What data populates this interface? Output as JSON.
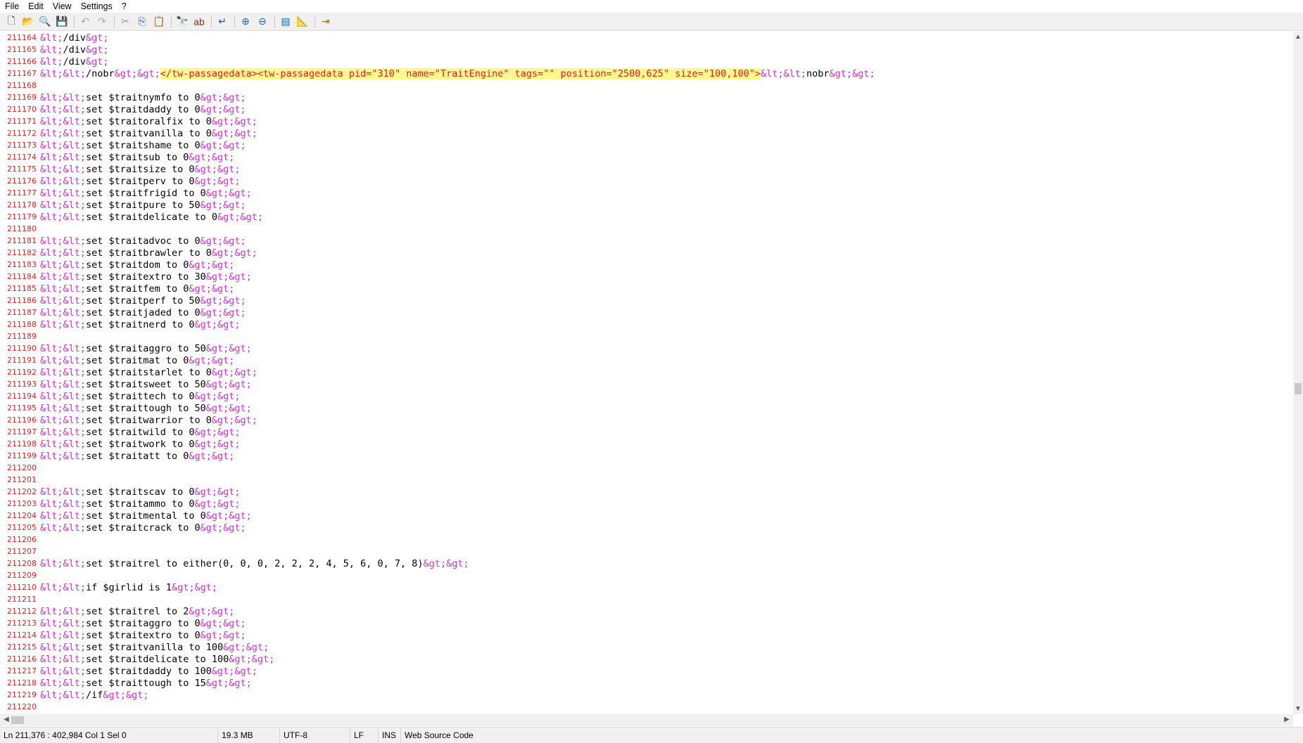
{
  "menu": [
    "File",
    "Edit",
    "View",
    "Settings",
    "?"
  ],
  "toolbar": [
    {
      "name": "new-file-icon",
      "g": "🗋",
      "c": "#333"
    },
    {
      "name": "open-file-icon",
      "g": "📂",
      "c": "#d8a020"
    },
    {
      "name": "browse-icon",
      "g": "🔍",
      "c": "#c89030"
    },
    {
      "name": "save-icon",
      "g": "💾",
      "c": "#3050a0"
    },
    {
      "sep": true
    },
    {
      "name": "undo-icon",
      "g": "↶",
      "c": "#9ab"
    },
    {
      "name": "redo-icon",
      "g": "↷",
      "c": "#9ab"
    },
    {
      "sep": true
    },
    {
      "name": "cut-icon",
      "g": "✂",
      "c": "#999"
    },
    {
      "name": "copy-icon",
      "g": "⎘",
      "c": "#3060b0"
    },
    {
      "name": "paste-icon",
      "g": "📋",
      "c": "#b08030"
    },
    {
      "sep": true
    },
    {
      "name": "find-icon",
      "g": "🔭",
      "c": "#333"
    },
    {
      "name": "replace-icon",
      "g": "ab",
      "c": "#a02020"
    },
    {
      "sep": true
    },
    {
      "name": "word-wrap-icon",
      "g": "↵",
      "c": "#2050a0"
    },
    {
      "sep": true
    },
    {
      "name": "zoom-in-icon",
      "g": "⊕",
      "c": "#3060a0"
    },
    {
      "name": "zoom-out-icon",
      "g": "⊖",
      "c": "#3060a0"
    },
    {
      "sep": true
    },
    {
      "name": "view-schemes-icon",
      "g": "▤",
      "c": "#2060b0"
    },
    {
      "name": "customize-icon",
      "g": "📐",
      "c": "#d09020"
    },
    {
      "sep": true
    },
    {
      "name": "exit-icon",
      "g": "⇥",
      "c": "#a07020"
    }
  ],
  "lines": [
    {
      "n": "211164",
      "code": "&lt;/div&gt;"
    },
    {
      "n": "211165",
      "code": "&lt;/div&gt;"
    },
    {
      "n": "211166",
      "code": "&lt;/div&gt;"
    },
    {
      "n": "211167",
      "code": "&lt;&lt;/nobr&gt;&gt;",
      "hl": "</tw-passagedata><tw-passagedata pid=\"310\" name=\"TraitEngine\" tags=\"\" position=\"2500,625\" size=\"100,100\">",
      "tail": "&lt;&lt;nobr&gt;&gt;"
    },
    {
      "n": "211168",
      "code": ""
    },
    {
      "n": "211169",
      "code": "&lt;&lt;set $traitnymfo to 0&gt;&gt;"
    },
    {
      "n": "211170",
      "code": "&lt;&lt;set $traitdaddy to 0&gt;&gt;"
    },
    {
      "n": "211171",
      "code": "&lt;&lt;set $traitoralfix to 0&gt;&gt;"
    },
    {
      "n": "211172",
      "code": "&lt;&lt;set $traitvanilla to 0&gt;&gt;"
    },
    {
      "n": "211173",
      "code": "&lt;&lt;set $traitshame to 0&gt;&gt;"
    },
    {
      "n": "211174",
      "code": "&lt;&lt;set $traitsub to 0&gt;&gt;"
    },
    {
      "n": "211175",
      "code": "&lt;&lt;set $traitsize to 0&gt;&gt;"
    },
    {
      "n": "211176",
      "code": "&lt;&lt;set $traitperv to 0&gt;&gt;"
    },
    {
      "n": "211177",
      "code": "&lt;&lt;set $traitfrigid to 0&gt;&gt;"
    },
    {
      "n": "211178",
      "code": "&lt;&lt;set $traitpure to 50&gt;&gt;"
    },
    {
      "n": "211179",
      "code": "&lt;&lt;set $traitdelicate to 0&gt;&gt;"
    },
    {
      "n": "211180",
      "code": ""
    },
    {
      "n": "211181",
      "code": "&lt;&lt;set $traitadvoc to 0&gt;&gt;"
    },
    {
      "n": "211182",
      "code": "&lt;&lt;set $traitbrawler to 0&gt;&gt;"
    },
    {
      "n": "211183",
      "code": "&lt;&lt;set $traitdom to 0&gt;&gt;"
    },
    {
      "n": "211184",
      "code": "&lt;&lt;set $traitextro to 30&gt;&gt;"
    },
    {
      "n": "211185",
      "code": "&lt;&lt;set $traitfem to 0&gt;&gt;"
    },
    {
      "n": "211186",
      "code": "&lt;&lt;set $traitperf to 50&gt;&gt;"
    },
    {
      "n": "211187",
      "code": "&lt;&lt;set $traitjaded to 0&gt;&gt;"
    },
    {
      "n": "211188",
      "code": "&lt;&lt;set $traitnerd to 0&gt;&gt;"
    },
    {
      "n": "211189",
      "code": ""
    },
    {
      "n": "211190",
      "code": "&lt;&lt;set $traitaggro to 50&gt;&gt;"
    },
    {
      "n": "211191",
      "code": "&lt;&lt;set $traitmat to 0&gt;&gt;"
    },
    {
      "n": "211192",
      "code": "&lt;&lt;set $traitstarlet to 0&gt;&gt;"
    },
    {
      "n": "211193",
      "code": "&lt;&lt;set $traitsweet to 50&gt;&gt;"
    },
    {
      "n": "211194",
      "code": "&lt;&lt;set $traittech to 0&gt;&gt;"
    },
    {
      "n": "211195",
      "code": "&lt;&lt;set $traittough to 50&gt;&gt;"
    },
    {
      "n": "211196",
      "code": "&lt;&lt;set $traitwarrior to 0&gt;&gt;"
    },
    {
      "n": "211197",
      "code": "&lt;&lt;set $traitwild to 0&gt;&gt;"
    },
    {
      "n": "211198",
      "code": "&lt;&lt;set $traitwork to 0&gt;&gt;"
    },
    {
      "n": "211199",
      "code": "&lt;&lt;set $traitatt to 0&gt;&gt;"
    },
    {
      "n": "211200",
      "code": ""
    },
    {
      "n": "211201",
      "code": ""
    },
    {
      "n": "211202",
      "code": "&lt;&lt;set $traitscav to 0&gt;&gt;"
    },
    {
      "n": "211203",
      "code": "&lt;&lt;set $traitammo to 0&gt;&gt;"
    },
    {
      "n": "211204",
      "code": "&lt;&lt;set $traitmental to 0&gt;&gt;"
    },
    {
      "n": "211205",
      "code": "&lt;&lt;set $traitcrack to 0&gt;&gt;"
    },
    {
      "n": "211206",
      "code": ""
    },
    {
      "n": "211207",
      "code": ""
    },
    {
      "n": "211208",
      "code": "&lt;&lt;set $traitrel to either(0, 0, 0, 2, 2, 2, 4, 5, 6, 0, 7, 8)&gt;&gt;"
    },
    {
      "n": "211209",
      "code": ""
    },
    {
      "n": "211210",
      "code": "&lt;&lt;if $girlid is 1&gt;&gt;"
    },
    {
      "n": "211211",
      "code": ""
    },
    {
      "n": "211212",
      "code": "&lt;&lt;set $traitrel to 2&gt;&gt;"
    },
    {
      "n": "211213",
      "code": "&lt;&lt;set $traitaggro to 0&gt;&gt;"
    },
    {
      "n": "211214",
      "code": "&lt;&lt;set $traitextro to 0&gt;&gt;"
    },
    {
      "n": "211215",
      "code": "&lt;&lt;set $traitvanilla to 100&gt;&gt;"
    },
    {
      "n": "211216",
      "code": "&lt;&lt;set $traitdelicate to 100&gt;&gt;"
    },
    {
      "n": "211217",
      "code": "&lt;&lt;set $traitdaddy to 100&gt;&gt;"
    },
    {
      "n": "211218",
      "code": "&lt;&lt;set $traittough to 15&gt;&gt;"
    },
    {
      "n": "211219",
      "code": "&lt;&lt;/if&gt;&gt;"
    },
    {
      "n": "211220",
      "code": ""
    }
  ],
  "status": {
    "position": "Ln 211,376 : 402,984   Col 1   Sel 0",
    "size": "19.3 MB",
    "encoding": "UTF-8",
    "eol": "LF",
    "mode": "INS",
    "lexer": "Web Source Code"
  }
}
